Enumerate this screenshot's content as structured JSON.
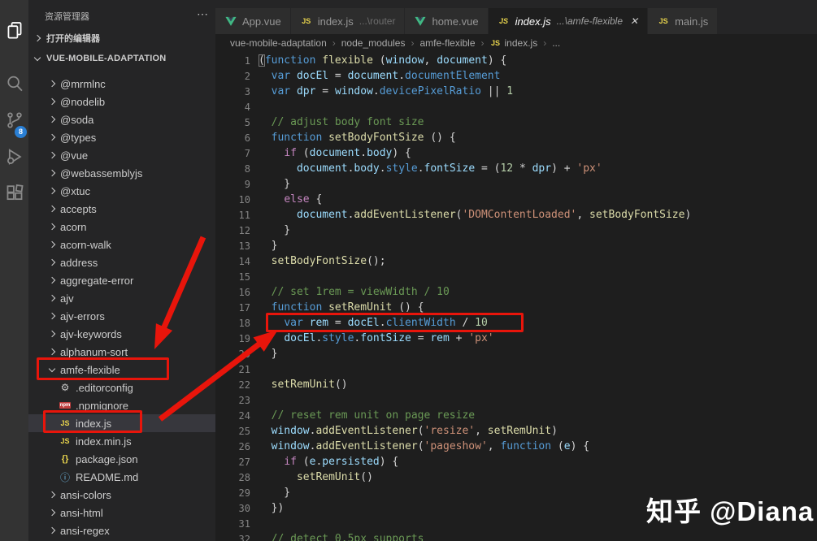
{
  "activity_bar": {
    "icons": [
      {
        "name": "explorer-icon",
        "active": true
      },
      {
        "name": "search-icon",
        "active": false
      },
      {
        "name": "source-control-icon",
        "active": false,
        "badge": "8"
      },
      {
        "name": "run-debug-icon",
        "active": false
      },
      {
        "name": "extensions-icon",
        "active": false
      }
    ]
  },
  "sidebar": {
    "title": "资源管理器",
    "more_actions": "⋯",
    "open_editors_label": "打开的编辑器",
    "workspace_label": "VUE-MOBILE-ADAPTATION",
    "tree": [
      {
        "label": "@mrmlnc",
        "kind": "folder",
        "level": 1
      },
      {
        "label": "@nodelib",
        "kind": "folder",
        "level": 1
      },
      {
        "label": "@soda",
        "kind": "folder",
        "level": 1
      },
      {
        "label": "@types",
        "kind": "folder",
        "level": 1
      },
      {
        "label": "@vue",
        "kind": "folder",
        "level": 1
      },
      {
        "label": "@webassemblyjs",
        "kind": "folder",
        "level": 1
      },
      {
        "label": "@xtuc",
        "kind": "folder",
        "level": 1
      },
      {
        "label": "accepts",
        "kind": "folder",
        "level": 1
      },
      {
        "label": "acorn",
        "kind": "folder",
        "level": 1
      },
      {
        "label": "acorn-walk",
        "kind": "folder",
        "level": 1
      },
      {
        "label": "address",
        "kind": "folder",
        "level": 1
      },
      {
        "label": "aggregate-error",
        "kind": "folder",
        "level": 1
      },
      {
        "label": "ajv",
        "kind": "folder",
        "level": 1
      },
      {
        "label": "ajv-errors",
        "kind": "folder",
        "level": 1
      },
      {
        "label": "ajv-keywords",
        "kind": "folder",
        "level": 1
      },
      {
        "label": "alphanum-sort",
        "kind": "folder",
        "level": 1
      },
      {
        "label": "amfe-flexible",
        "kind": "folder",
        "level": 1,
        "expanded": true
      },
      {
        "label": ".editorconfig",
        "kind": "file",
        "icon": "gear",
        "level": 2
      },
      {
        "label": ".npmignore",
        "kind": "file",
        "icon": "npm",
        "level": 2
      },
      {
        "label": "index.js",
        "kind": "file",
        "icon": "js",
        "level": 2,
        "selected": true
      },
      {
        "label": "index.min.js",
        "kind": "file",
        "icon": "js",
        "level": 2
      },
      {
        "label": "package.json",
        "kind": "file",
        "icon": "json",
        "level": 2
      },
      {
        "label": "README.md",
        "kind": "file",
        "icon": "info",
        "level": 2
      },
      {
        "label": "ansi-colors",
        "kind": "folder",
        "level": 1
      },
      {
        "label": "ansi-html",
        "kind": "folder",
        "level": 1
      },
      {
        "label": "ansi-regex",
        "kind": "folder",
        "level": 1
      }
    ]
  },
  "tabs": [
    {
      "icon": "vue",
      "label": "App.vue",
      "active": false
    },
    {
      "icon": "js",
      "label": "index.js",
      "desc": "...\\router",
      "active": false
    },
    {
      "icon": "vue",
      "label": "home.vue",
      "active": false
    },
    {
      "icon": "js",
      "label": "index.js",
      "desc": "...\\amfe-flexible",
      "active": true,
      "close": "✕"
    },
    {
      "icon": "js",
      "label": "main.js",
      "active": false
    }
  ],
  "breadcrumb": [
    {
      "label": "vue-mobile-adaptation"
    },
    {
      "label": "node_modules"
    },
    {
      "label": "amfe-flexible"
    },
    {
      "label": "index.js",
      "icon": "js"
    },
    {
      "label": "..."
    }
  ],
  "editor": {
    "lines": [
      {
        "n": 1,
        "t": [
          [
            "pb",
            "("
          ],
          [
            "kw",
            "function"
          ],
          [
            "pl",
            " "
          ],
          [
            "fn",
            "flexible"
          ],
          [
            "pl",
            " ("
          ],
          [
            "vr",
            "window"
          ],
          [
            "pl",
            ", "
          ],
          [
            "vr",
            "document"
          ],
          [
            "pl",
            ") {"
          ]
        ]
      },
      {
        "n": 2,
        "t": [
          [
            "pl",
            "  "
          ],
          [
            "kw",
            "var"
          ],
          [
            "pl",
            " "
          ],
          [
            "vr",
            "docEl"
          ],
          [
            "pl",
            " = "
          ],
          [
            "vr",
            "document"
          ],
          [
            "pl",
            "."
          ],
          [
            "pr",
            "documentElement"
          ]
        ]
      },
      {
        "n": 3,
        "t": [
          [
            "pl",
            "  "
          ],
          [
            "kw",
            "var"
          ],
          [
            "pl",
            " "
          ],
          [
            "vr",
            "dpr"
          ],
          [
            "pl",
            " = "
          ],
          [
            "vr",
            "window"
          ],
          [
            "pl",
            "."
          ],
          [
            "pr",
            "devicePixelRatio"
          ],
          [
            "pl",
            " || "
          ],
          [
            "nm",
            "1"
          ]
        ]
      },
      {
        "n": 4,
        "t": []
      },
      {
        "n": 5,
        "t": [
          [
            "cm",
            "  // adjust body font size"
          ]
        ]
      },
      {
        "n": 6,
        "t": [
          [
            "pl",
            "  "
          ],
          [
            "kw",
            "function"
          ],
          [
            "pl",
            " "
          ],
          [
            "fn",
            "setBodyFontSize"
          ],
          [
            "pl",
            " () {"
          ]
        ]
      },
      {
        "n": 7,
        "t": [
          [
            "pl",
            "    "
          ],
          [
            "ct",
            "if"
          ],
          [
            "pl",
            " ("
          ],
          [
            "vr",
            "document"
          ],
          [
            "pl",
            "."
          ],
          [
            "vr",
            "body"
          ],
          [
            "pl",
            ") {"
          ]
        ]
      },
      {
        "n": 8,
        "t": [
          [
            "pl",
            "      "
          ],
          [
            "vr",
            "document"
          ],
          [
            "pl",
            "."
          ],
          [
            "vr",
            "body"
          ],
          [
            "pl",
            "."
          ],
          [
            "pr",
            "style"
          ],
          [
            "pl",
            "."
          ],
          [
            "vr",
            "fontSize"
          ],
          [
            "pl",
            " = ("
          ],
          [
            "nm",
            "12"
          ],
          [
            "pl",
            " * "
          ],
          [
            "vr",
            "dpr"
          ],
          [
            "pl",
            ") + "
          ],
          [
            "st",
            "'px'"
          ]
        ]
      },
      {
        "n": 9,
        "t": [
          [
            "pl",
            "    }"
          ]
        ]
      },
      {
        "n": 10,
        "t": [
          [
            "pl",
            "    "
          ],
          [
            "ct",
            "else"
          ],
          [
            "pl",
            " {"
          ]
        ]
      },
      {
        "n": 11,
        "t": [
          [
            "pl",
            "      "
          ],
          [
            "vr",
            "document"
          ],
          [
            "pl",
            "."
          ],
          [
            "fn",
            "addEventListener"
          ],
          [
            "pl",
            "("
          ],
          [
            "st",
            "'DOMContentLoaded'"
          ],
          [
            "pl",
            ", "
          ],
          [
            "fn",
            "setBodyFontSize"
          ],
          [
            "pl",
            ")"
          ]
        ]
      },
      {
        "n": 12,
        "t": [
          [
            "pl",
            "    }"
          ]
        ]
      },
      {
        "n": 13,
        "t": [
          [
            "pl",
            "  }"
          ]
        ]
      },
      {
        "n": 14,
        "t": [
          [
            "pl",
            "  "
          ],
          [
            "fn",
            "setBodyFontSize"
          ],
          [
            "pl",
            "();"
          ]
        ]
      },
      {
        "n": 15,
        "t": []
      },
      {
        "n": 16,
        "t": [
          [
            "cm",
            "  // set 1rem = viewWidth / 10"
          ]
        ]
      },
      {
        "n": 17,
        "t": [
          [
            "pl",
            "  "
          ],
          [
            "kw",
            "function"
          ],
          [
            "pl",
            " "
          ],
          [
            "fn",
            "setRemUnit"
          ],
          [
            "pl",
            " () {"
          ]
        ]
      },
      {
        "n": 18,
        "t": [
          [
            "pl",
            "    "
          ],
          [
            "kw",
            "var"
          ],
          [
            "pl",
            " "
          ],
          [
            "vr",
            "rem"
          ],
          [
            "pl",
            " = "
          ],
          [
            "vr",
            "docEl"
          ],
          [
            "pl",
            "."
          ],
          [
            "pr",
            "clientWidth"
          ],
          [
            "pl",
            " / "
          ],
          [
            "nm",
            "10"
          ]
        ]
      },
      {
        "n": 19,
        "t": [
          [
            "pl",
            "    "
          ],
          [
            "vr",
            "docEl"
          ],
          [
            "pl",
            "."
          ],
          [
            "pr",
            "style"
          ],
          [
            "pl",
            "."
          ],
          [
            "vr",
            "fontSize"
          ],
          [
            "pl",
            " = "
          ],
          [
            "vr",
            "rem"
          ],
          [
            "pl",
            " + "
          ],
          [
            "st",
            "'px'"
          ]
        ]
      },
      {
        "n": 20,
        "t": [
          [
            "pl",
            "  }"
          ]
        ]
      },
      {
        "n": 21,
        "t": []
      },
      {
        "n": 22,
        "t": [
          [
            "pl",
            "  "
          ],
          [
            "fn",
            "setRemUnit"
          ],
          [
            "pl",
            "()"
          ]
        ]
      },
      {
        "n": 23,
        "t": []
      },
      {
        "n": 24,
        "t": [
          [
            "cm",
            "  // reset rem unit on page resize"
          ]
        ]
      },
      {
        "n": 25,
        "t": [
          [
            "pl",
            "  "
          ],
          [
            "vr",
            "window"
          ],
          [
            "pl",
            "."
          ],
          [
            "fn",
            "addEventListener"
          ],
          [
            "pl",
            "("
          ],
          [
            "st",
            "'resize'"
          ],
          [
            "pl",
            ", "
          ],
          [
            "fn",
            "setRemUnit"
          ],
          [
            "pl",
            ")"
          ]
        ]
      },
      {
        "n": 26,
        "t": [
          [
            "pl",
            "  "
          ],
          [
            "vr",
            "window"
          ],
          [
            "pl",
            "."
          ],
          [
            "fn",
            "addEventListener"
          ],
          [
            "pl",
            "("
          ],
          [
            "st",
            "'pageshow'"
          ],
          [
            "pl",
            ", "
          ],
          [
            "kw",
            "function"
          ],
          [
            "pl",
            " ("
          ],
          [
            "vr",
            "e"
          ],
          [
            "pl",
            ") {"
          ]
        ]
      },
      {
        "n": 27,
        "t": [
          [
            "pl",
            "    "
          ],
          [
            "ct",
            "if"
          ],
          [
            "pl",
            " ("
          ],
          [
            "vr",
            "e"
          ],
          [
            "pl",
            "."
          ],
          [
            "vr",
            "persisted"
          ],
          [
            "pl",
            ") {"
          ]
        ]
      },
      {
        "n": 28,
        "t": [
          [
            "pl",
            "      "
          ],
          [
            "fn",
            "setRemUnit"
          ],
          [
            "pl",
            "()"
          ]
        ]
      },
      {
        "n": 29,
        "t": [
          [
            "pl",
            "    }"
          ]
        ]
      },
      {
        "n": 30,
        "t": [
          [
            "pl",
            "  })"
          ]
        ]
      },
      {
        "n": 31,
        "t": []
      },
      {
        "n": 32,
        "t": [
          [
            "cm",
            "  // detect 0.5px supports"
          ]
        ]
      }
    ]
  },
  "annotations": {
    "highlight_color": "#e8150b",
    "boxed_items": [
      "amfe-flexible",
      "index.js",
      "line-18"
    ]
  },
  "watermark": "知乎 @Diana",
  "colors": {
    "activity_bar_bg": "#333333",
    "sidebar_bg": "#252526",
    "editor_bg": "#1e1e1e",
    "tab_inactive_bg": "#2d2d2d",
    "tab_active_bg": "#1e1e1e",
    "selection_bg": "#37373d",
    "badge_blue": "#2a7fd4",
    "js_yellow": "#e8d44d",
    "vue_green": "#41b883",
    "keyword": "#569CD6",
    "control": "#C586C0",
    "function": "#DCDCAA",
    "variable": "#9CDCFE",
    "number": "#B5CEA8",
    "string": "#CE9178",
    "comment": "#6A9955",
    "annotation_red": "#e8150b"
  }
}
